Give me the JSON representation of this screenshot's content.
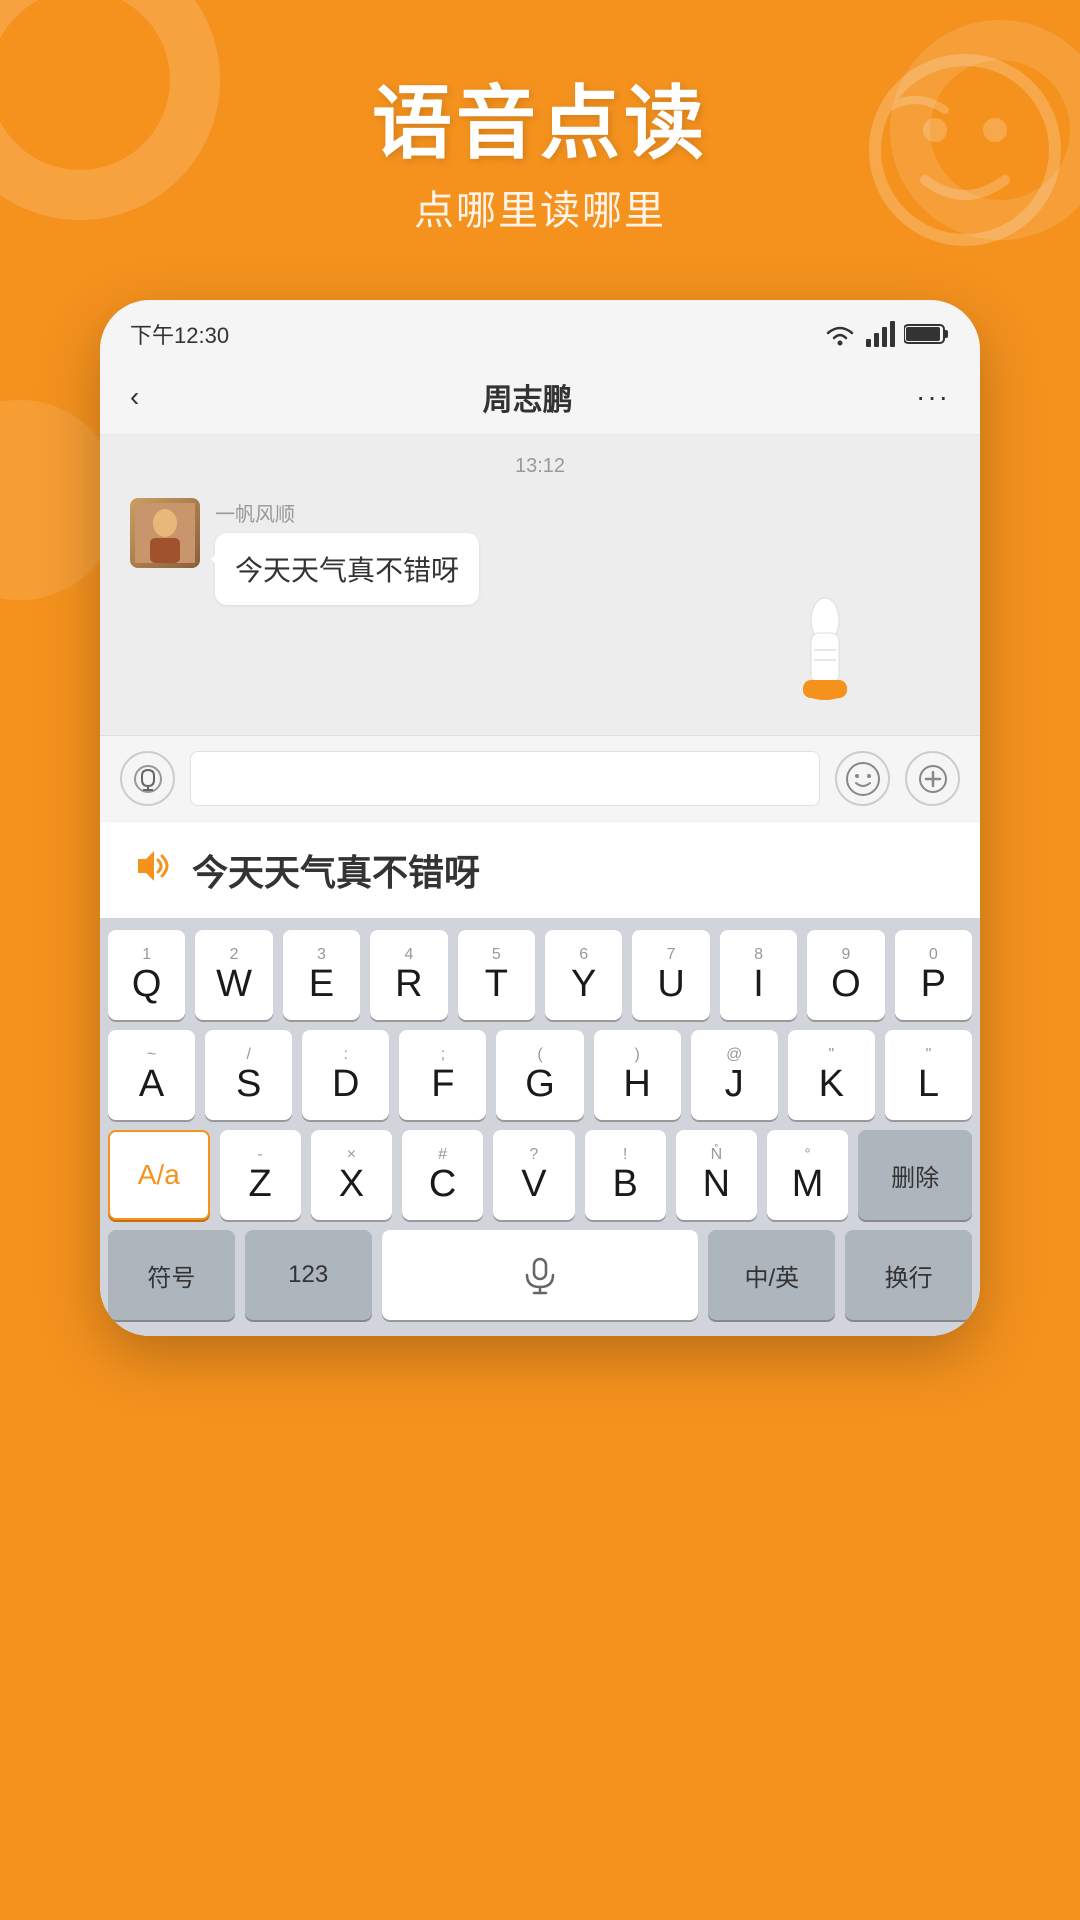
{
  "background_color": "#F5921E",
  "header": {
    "title_main": "语音点读",
    "title_sub": "点哪里读哪里"
  },
  "status_bar": {
    "time": "下午12:30",
    "wifi": "wifi",
    "signal": "signal",
    "battery": "battery"
  },
  "nav": {
    "back_label": "‹",
    "title": "周志鹏",
    "more_label": "···"
  },
  "chat": {
    "timestamp": "13:12",
    "sender_name": "一帆风顺",
    "message_text": "今天天气真不错呀"
  },
  "tts": {
    "text": "今天天气真不错呀"
  },
  "keyboard": {
    "row1": [
      {
        "num": "1",
        "letter": "Q"
      },
      {
        "num": "2",
        "letter": "W"
      },
      {
        "num": "3",
        "letter": "E"
      },
      {
        "num": "4",
        "letter": "R"
      },
      {
        "num": "5",
        "letter": "T"
      },
      {
        "num": "6",
        "letter": "Y"
      },
      {
        "num": "7",
        "letter": "U"
      },
      {
        "num": "8",
        "letter": "I"
      },
      {
        "num": "9",
        "letter": "O"
      },
      {
        "num": "0",
        "letter": "P"
      }
    ],
    "row2": [
      {
        "num": "~",
        "letter": "A"
      },
      {
        "num": "/",
        "letter": "S"
      },
      {
        "num": ":",
        "letter": "D"
      },
      {
        "num": ";",
        "letter": "F"
      },
      {
        "num": "(",
        "letter": "G"
      },
      {
        "num": ")",
        "letter": "H"
      },
      {
        "num": "@",
        "letter": "J"
      },
      {
        "num": "\"",
        "letter": "K"
      },
      {
        "num": "\"",
        "letter": "L"
      }
    ],
    "row3": [
      {
        "type": "shift",
        "label": "A/a"
      },
      {
        "num": "-",
        "letter": "Z"
      },
      {
        "num": "×",
        "letter": "X"
      },
      {
        "num": "#",
        "letter": "C"
      },
      {
        "num": "?",
        "letter": "V"
      },
      {
        "num": "!",
        "letter": "B"
      },
      {
        "num": "N̊",
        "letter": "N"
      },
      {
        "num": "°",
        "letter": "M"
      },
      {
        "type": "delete",
        "label": "删除"
      }
    ],
    "row4": [
      {
        "type": "func",
        "label": "符号"
      },
      {
        "type": "func",
        "label": "123"
      },
      {
        "type": "space",
        "label": "mic"
      },
      {
        "type": "func",
        "label": "中/英"
      },
      {
        "type": "func",
        "label": "换行"
      }
    ]
  }
}
